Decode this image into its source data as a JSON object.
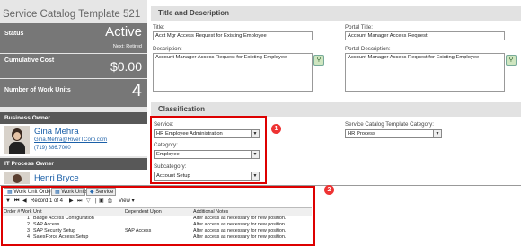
{
  "left": {
    "title": "Service Catalog Template 521",
    "status_label": "Status",
    "status_value": "Active",
    "next_link": "Next: Retired",
    "cost_label": "Cumulative Cost",
    "cost_value": "$0.00",
    "units_label": "Number of Work Units",
    "units_value": "4",
    "business_owner_header": "Business Owner",
    "business_owner_name": "Gina Mehra",
    "business_owner_email": "Gina.Mehra@RiverTCorp.com",
    "business_owner_phone": "(719) 386.7000",
    "it_owner_header": "IT Process Owner",
    "it_owner_name": "Henri Bryce"
  },
  "title_section": {
    "header": "Title and Description",
    "title_label": "Title:",
    "title_value": "Acct Mgr Access Request for Existing Employee",
    "portal_title_label": "Portal Title:",
    "portal_title_value": "Account Manager Access Request",
    "description_label": "Description:",
    "description_value": "Account Manager Access Request for Existing Employee",
    "portal_description_label": "Portal Description:",
    "portal_description_value": "Account Manager Access Request for Existing Employee"
  },
  "classification": {
    "header": "Classification",
    "service_label": "Service:",
    "service_value": "HR Employee Administration",
    "category_label": "Category:",
    "category_value": "Employee",
    "subcategory_label": "Subcategory:",
    "subcategory_value": "Account Setup",
    "template_category_label": "Service Catalog Template Category:",
    "template_category_value": "HR Process"
  },
  "callouts": [
    "1",
    "2"
  ],
  "tabs": [
    "Work Unit Order",
    "Work Units",
    "Service"
  ],
  "toolbar": {
    "record_text": "Record 1 of 4",
    "view_label": "View"
  },
  "grid": {
    "columns": [
      "Order #",
      "Work Unit",
      "Dependent Upon",
      "Additional Notes"
    ],
    "rows": [
      {
        "order": "1",
        "unit": "Badge Access Configuration",
        "dep": "",
        "notes": "Alter access as necessary for new position."
      },
      {
        "order": "2",
        "unit": "SAP Access",
        "dep": "",
        "notes": "Alter access as necessary for new position."
      },
      {
        "order": "3",
        "unit": "SAP Security Setup",
        "dep": "SAP Access",
        "notes": "Alter access as necessary for new position."
      },
      {
        "order": "4",
        "unit": "SalesForce Access Setup",
        "dep": "",
        "notes": "Alter access as necessary for new position."
      }
    ]
  }
}
